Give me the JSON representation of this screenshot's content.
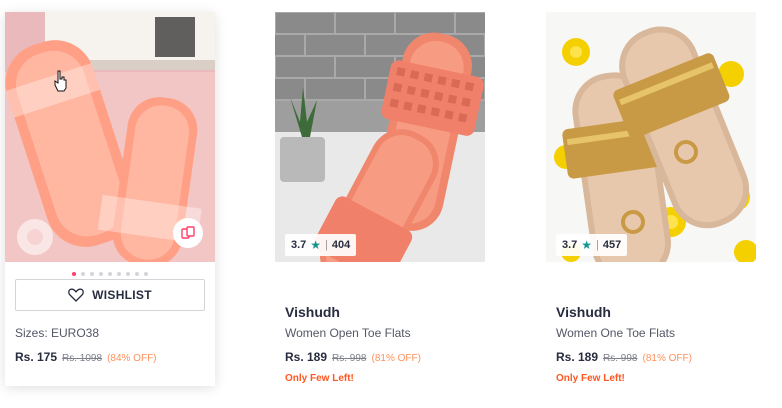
{
  "products": [
    {
      "sizes": "Sizes: EURO38",
      "price": "Rs. 175",
      "mrp": "Rs. 1098",
      "discount": "(84% OFF)",
      "wishlist_label": "WISHLIST"
    },
    {
      "rating": "3.7",
      "rating_count": "404",
      "brand": "Vishudh",
      "name": "Women Open Toe Flats",
      "price": "Rs. 189",
      "mrp": "Rs. 998",
      "discount": "(81% OFF)",
      "stock_note": "Only Few Left!"
    },
    {
      "rating": "3.7",
      "rating_count": "457",
      "brand": "Vishudh",
      "name": "Women One Toe Flats",
      "price": "Rs. 189",
      "mrp": "Rs. 998",
      "discount": "(81% OFF)",
      "stock_note": "Only Few Left!"
    }
  ],
  "carousel": {
    "total": 9,
    "active": 0
  },
  "colors": {
    "accent": "#ff3f6c",
    "discount": "#ff905a",
    "stock": "#ff5722",
    "star": "#14958f"
  }
}
